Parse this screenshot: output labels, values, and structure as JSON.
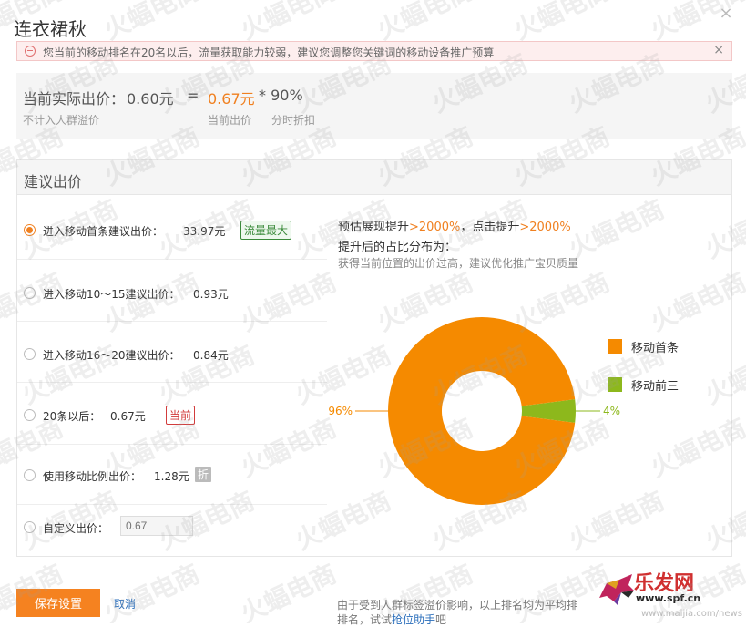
{
  "dialog": {
    "title": "连衣裙秋",
    "close_icon": "close-icon"
  },
  "alert": {
    "message": "您当前的移动排名在20名以后，流量获取能力较弱，建议您调整您关键词的移动设备推广预算",
    "close": "×"
  },
  "current": {
    "label": "当前实际出价：",
    "value": "0.60元",
    "equals": "=",
    "bid": "0.67元",
    "multiplier": "* 90%",
    "note_left": "不计入人群溢价",
    "note_bid": "当前出价",
    "note_discount": "分时折扣"
  },
  "suggest": {
    "title": "建议出价",
    "options": [
      {
        "label": "进入移动首条建议出价：",
        "value": "33.97元",
        "tag": "流量最大",
        "selected": true
      },
      {
        "label": "进入移动10～15建议出价：",
        "value": "0.93元",
        "tag": "",
        "selected": false
      },
      {
        "label": "进入移动16～20建议出价：",
        "value": "0.84元",
        "tag": "",
        "selected": false
      },
      {
        "label": "20条以后：",
        "value": "0.67元",
        "tag": "当前",
        "selected": false
      },
      {
        "label": "使用移动比例出价：",
        "value": "1.28元",
        "tag": "折",
        "selected": false
      },
      {
        "label": "自定义出价：",
        "value": "",
        "tag": "",
        "selected": false
      }
    ],
    "custom_placeholder": "0.67"
  },
  "estimate": {
    "line1_a": "预估展现提升",
    "line1_b": ">2000%",
    "line1_c": "，点击提升",
    "line1_d": ">2000%",
    "line2": "提升后的占比分布为：",
    "line3": "获得当前位置的出价过高，建议优化推广宝贝质量"
  },
  "chart_data": {
    "type": "pie",
    "donut": true,
    "slices": [
      {
        "name": "移动首条",
        "value": 96,
        "label": "96%",
        "color": "#f58a00"
      },
      {
        "name": "移动前三",
        "value": 4,
        "label": "4%",
        "color": "#8db81c"
      }
    ],
    "legend_placement": "right"
  },
  "footer": {
    "save_label": "保存设置",
    "cancel_label": "取消",
    "note1": "由于受到人群标签溢价影响，以上排名均为平均排",
    "note2a": "排名，试试",
    "note2b": "抢位助手",
    "note2c": "吧"
  },
  "watermark": {
    "text": "火蝠电商"
  },
  "logo": {
    "brand": "乐发网",
    "url": "www.spf.cn",
    "credit": "www.maijia.com/news"
  }
}
